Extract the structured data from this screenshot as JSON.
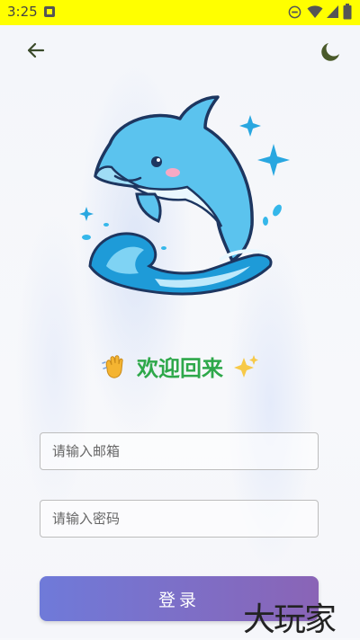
{
  "status_bar": {
    "time": "3:25",
    "icons": [
      "notification-icon",
      "dnd-icon",
      "wifi-icon",
      "signal-icon",
      "battery-icon"
    ]
  },
  "header": {
    "back_icon": "arrow-left-icon",
    "theme_icon": "moon-icon"
  },
  "hero": {
    "image": "dolphin-illustration"
  },
  "welcome": {
    "title": "欢迎回来",
    "emoji_left": "waving-hand",
    "emoji_right": "sparkles"
  },
  "form": {
    "email_placeholder": "请输入邮箱",
    "password_placeholder": "请输入密码",
    "login_label": "登录"
  },
  "watermark": {
    "text": "大玩家"
  },
  "colors": {
    "title_green": "#2ea84a",
    "button_start": "#6f7ad9",
    "button_end": "#8a64b6",
    "status_bar": "#ffff00"
  }
}
